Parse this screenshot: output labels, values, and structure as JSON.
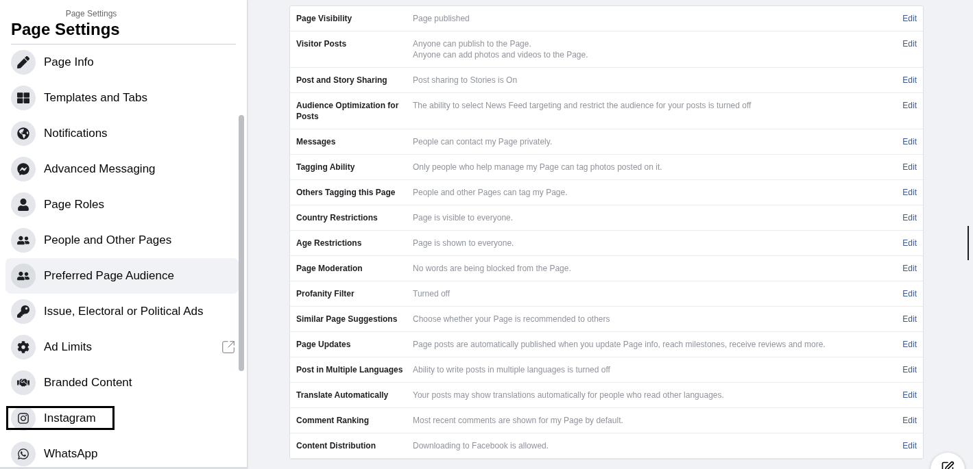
{
  "sidebar": {
    "breadcrumb": "Page Settings",
    "title": "Page Settings",
    "items": [
      {
        "label": "Page Info",
        "selected": false,
        "external": false,
        "boxed": false
      },
      {
        "label": "Templates and Tabs",
        "selected": false,
        "external": false,
        "boxed": false
      },
      {
        "label": "Notifications",
        "selected": false,
        "external": false,
        "boxed": false
      },
      {
        "label": "Advanced Messaging",
        "selected": false,
        "external": false,
        "boxed": false
      },
      {
        "label": "Page Roles",
        "selected": false,
        "external": false,
        "boxed": false
      },
      {
        "label": "People and Other Pages",
        "selected": false,
        "external": false,
        "boxed": false
      },
      {
        "label": "Preferred Page Audience",
        "selected": true,
        "external": false,
        "boxed": false
      },
      {
        "label": "Issue, Electoral or Political Ads",
        "selected": false,
        "external": false,
        "boxed": false
      },
      {
        "label": "Ad Limits",
        "selected": false,
        "external": true,
        "boxed": false
      },
      {
        "label": "Branded Content",
        "selected": false,
        "external": false,
        "boxed": false
      },
      {
        "label": "Instagram",
        "selected": false,
        "external": false,
        "boxed": true
      },
      {
        "label": "WhatsApp",
        "selected": false,
        "external": false,
        "boxed": false
      }
    ]
  },
  "settings": {
    "rows": [
      {
        "name": "Page Visibility",
        "value": [
          "Page published"
        ],
        "action": "Edit"
      },
      {
        "name": "Visitor Posts",
        "value": [
          "Anyone can publish to the Page.",
          "Anyone can add photos and videos to the Page."
        ],
        "action": "Edit"
      },
      {
        "name": "Post and Story Sharing",
        "value": [
          "Post sharing to Stories is On"
        ],
        "action": "Edit"
      },
      {
        "name": "Audience Optimization for Posts",
        "value": [
          "The ability to select News Feed targeting and restrict the audience for your posts is turned off"
        ],
        "action": "Edit"
      },
      {
        "name": "Messages",
        "value": [
          "People can contact my Page privately."
        ],
        "action": "Edit"
      },
      {
        "name": "Tagging Ability",
        "value": [
          "Only people who help manage my Page can tag photos posted on it."
        ],
        "action": "Edit"
      },
      {
        "name": "Others Tagging this Page",
        "value": [
          "People and other Pages can tag my Page."
        ],
        "action": "Edit"
      },
      {
        "name": "Country Restrictions",
        "value": [
          "Page is visible to everyone."
        ],
        "action": "Edit"
      },
      {
        "name": "Age Restrictions",
        "value": [
          "Page is shown to everyone."
        ],
        "action": "Edit"
      },
      {
        "name": "Page Moderation",
        "value": [
          "No words are being blocked from the Page."
        ],
        "action": "Edit"
      },
      {
        "name": "Profanity Filter",
        "value": [
          "Turned off"
        ],
        "action": "Edit"
      },
      {
        "name": "Similar Page Suggestions",
        "value": [
          "Choose whether your Page is recommended to others"
        ],
        "action": "Edit"
      },
      {
        "name": "Page Updates",
        "value": [
          "Page posts are automatically published when you update Page info, reach milestones, receive reviews and more."
        ],
        "action": "Edit"
      },
      {
        "name": "Post in Multiple Languages",
        "value": [
          "Ability to write posts in multiple languages is turned off"
        ],
        "action": "Edit"
      },
      {
        "name": "Translate Automatically",
        "value": [
          "Your posts may show translations automatically for people who read other languages."
        ],
        "action": "Edit"
      },
      {
        "name": "Comment Ranking",
        "value": [
          "Most recent comments are shown for my Page by default."
        ],
        "action": "Edit"
      },
      {
        "name": "Content Distribution",
        "value": [
          "Downloading to Facebook is allowed."
        ],
        "action": "Edit"
      }
    ]
  }
}
